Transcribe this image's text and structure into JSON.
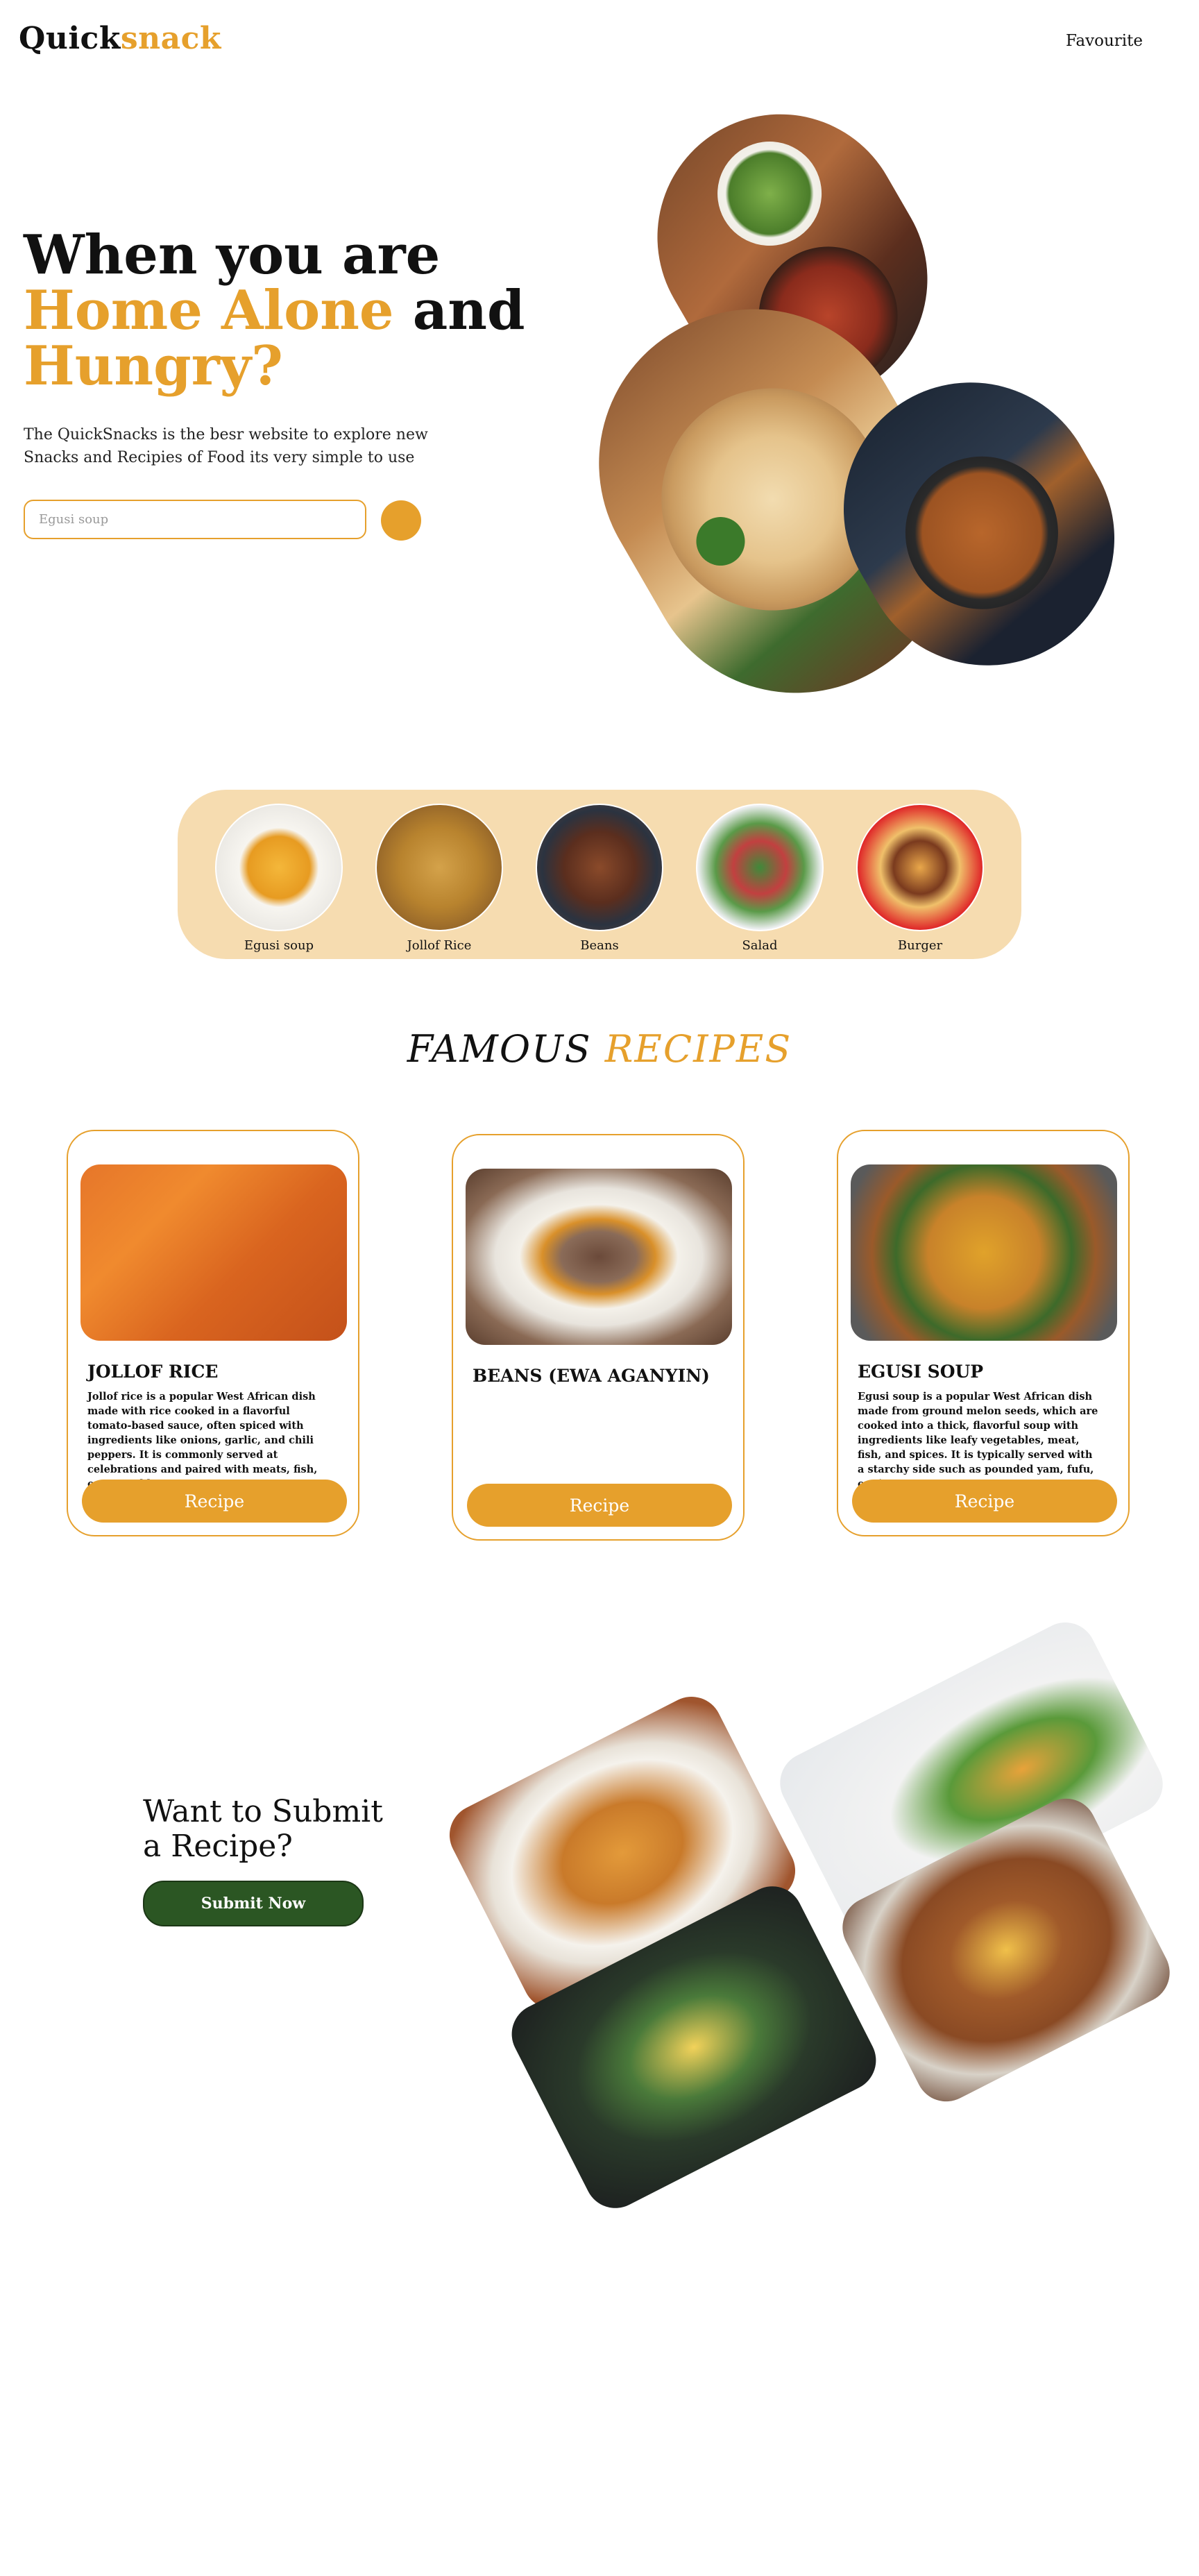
{
  "header": {
    "logo_part1": "Quick",
    "logo_part2": "snack",
    "nav_favourite": "Favourite"
  },
  "hero": {
    "title_line1": "When you are",
    "title_highlight": "Home Alone",
    "title_and": " and",
    "title_line3": "Hungry?",
    "description": "The QuickSnacks is the besr website to explore new Snacks and  Recipies of Food its very simple to use",
    "search_placeholder": "Egusi soup"
  },
  "categories": [
    {
      "label": "Egusi soup"
    },
    {
      "label": "Jollof Rice"
    },
    {
      "label": "Beans"
    },
    {
      "label": "Salad"
    },
    {
      "label": "Burger"
    }
  ],
  "famous": {
    "word1": "FAMOUS",
    "word2": "RECIPES"
  },
  "recipes": [
    {
      "title": "JOLLOF RICE",
      "description": "Jollof rice is a popular West African dish made with rice cooked in a flavorful tomato-based sauce, often spiced with ingredients like onions, garlic, and chili peppers. It is commonly served at celebrations and paired with meats, fish, or vegetables.",
      "button": "Recipe"
    },
    {
      "title": "BEANS (EWA AGANYIN)",
      "description": "",
      "button": "Recipe"
    },
    {
      "title": "EGUSI SOUP",
      "description": "Egusi soup is a popular West African dish made from ground melon seeds, which are cooked into a thick, flavorful soup with ingredients like leafy vegetables, meat, fish, and spices. It is typically served with a starchy side such as pounded yam, fufu, or rice.",
      "button": "Recipe"
    }
  ],
  "submit": {
    "title_line1": "Want to Submit",
    "title_line2": "a Recipe?",
    "button": "Submit Now"
  },
  "colors": {
    "accent": "#e6a02c",
    "category_bg": "#f6dcb0",
    "submit_green": "#2b5623"
  }
}
